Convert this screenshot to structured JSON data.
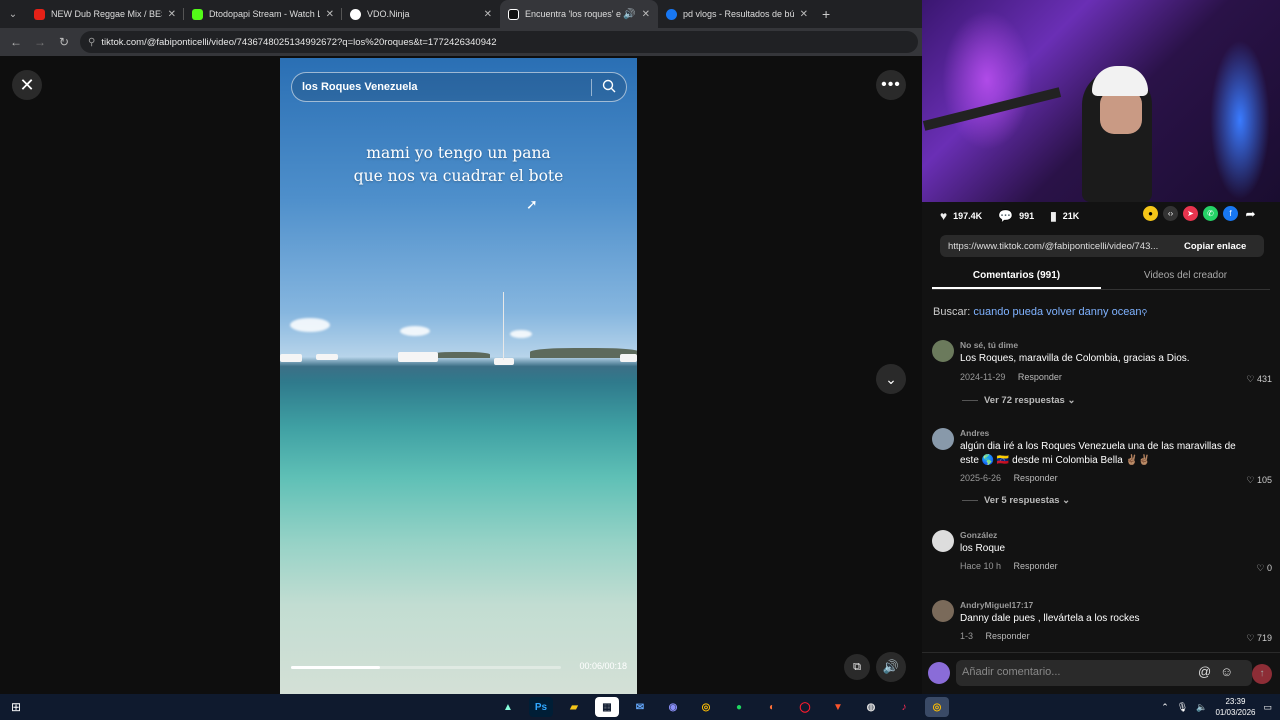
{
  "browser": {
    "tabs": [
      {
        "title": "NEW Dub Reggae Mix / BEST R",
        "color": "#e62117"
      },
      {
        "title": "Dtodopapi Stream - Watch Liv",
        "color": "#53fc18"
      },
      {
        "title": "VDO.Ninja",
        "color": "#ffffff"
      },
      {
        "title": "Encuentra 'los roques' en Ti",
        "color": "#ffffff"
      },
      {
        "title": "pd vlogs - Resultados de búsq",
        "color": "#1877f2"
      }
    ],
    "url": "tiktok.com/@fabiponticelli/video/7436748025134992672?q=los%20roques&t=1772426340942"
  },
  "video": {
    "search_query": "los Roques Venezuela",
    "caption_line1": "mami yo tengo un pana",
    "caption_line2": "que nos va cuadrar el bote",
    "timecode": "00:06/00:18",
    "progress": 0.33
  },
  "stats": {
    "likes": "197.4K",
    "comments": "991",
    "saves": "21K"
  },
  "share": {
    "url": "https://www.tiktok.com/@fabiponticelli/video/743...",
    "copy_label": "Copiar enlace"
  },
  "tabs": {
    "comments": "Comentarios (991)",
    "creator_videos": "Videos del creador"
  },
  "search_line": {
    "label": "Buscar:",
    "query": "cuando pueda volver danny ocean"
  },
  "comments": [
    {
      "user": "No sé, tú dime",
      "text": "Los Roques, maravilla de Colombia, gracias a Dios.",
      "date": "2024-11-29",
      "reply": "Responder",
      "likes": "431",
      "replies": "Ver 72 respuestas"
    },
    {
      "user": "Andres",
      "text": "algún dia iré a los Roques Venezuela una de las maravillas de este 🌎 🇻🇪 desde mi Colombia Bella ✌🏽✌🏽",
      "date": "2025-6-26",
      "reply": "Responder",
      "likes": "105",
      "replies": "Ver 5 respuestas"
    },
    {
      "user": "González",
      "text": "los Roque",
      "date": "Hace 10 h",
      "reply": "Responder",
      "likes": "0",
      "replies": ""
    },
    {
      "user": "AndryMiguel17:17",
      "text": "Danny dale pues , llevártela a los rockes",
      "date": "1-3",
      "reply": "Responder",
      "likes": "719",
      "replies": ""
    }
  ],
  "add_comment_placeholder": "Añadir comentario...",
  "taskbar": {
    "time": "23:39",
    "date": "01/03/2026"
  }
}
